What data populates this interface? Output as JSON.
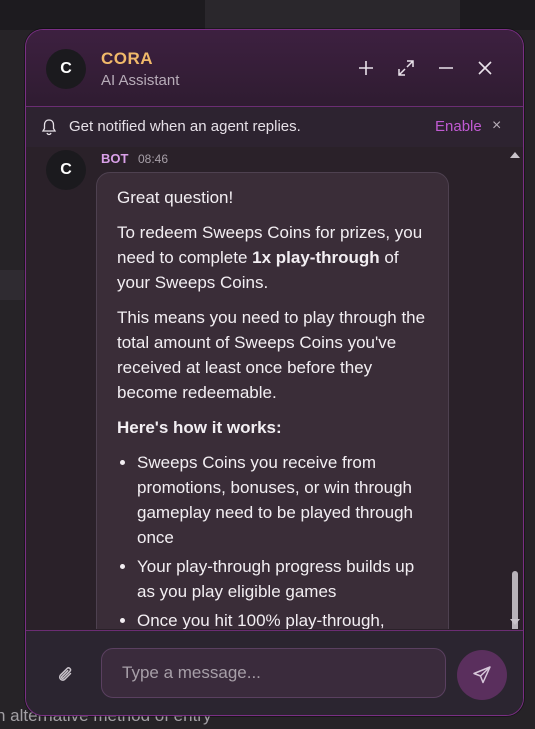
{
  "background": {
    "bottom_text": "n alternative method of entry"
  },
  "header": {
    "avatar_letter": "C",
    "title": "CORA",
    "subtitle": "AI Assistant",
    "icons": [
      "plus-icon",
      "expand-icon",
      "minimize-icon",
      "close-icon"
    ]
  },
  "notice": {
    "text": "Get notified when an agent replies.",
    "enable_label": "Enable",
    "close_glyph": "×"
  },
  "message": {
    "avatar_letter": "C",
    "sender": "BOT",
    "time": "08:46",
    "greeting": "Great question!",
    "p1_before": "To redeem Sweeps Coins for prizes, you need to complete ",
    "p1_bold": "1x play-through",
    "p1_after": " of your Sweeps Coins.",
    "p2": "This means you need to play through the total amount of Sweeps Coins you've received at least once before they become redeemable.",
    "how_heading": "Here's how it works:",
    "bullets": [
      "Sweeps Coins you receive from promotions, bonuses, or win through gameplay need to be played through once",
      "Your play-through progress builds up as you play eligible games",
      "Once you hit 100% play-through,"
    ]
  },
  "composer": {
    "placeholder": "Type a message..."
  },
  "colors": {
    "accent_border": "#7a2f84",
    "title_color": "#f0b96a",
    "enable_link": "#c05ad2",
    "bubble_bg": "#3a2d38"
  }
}
